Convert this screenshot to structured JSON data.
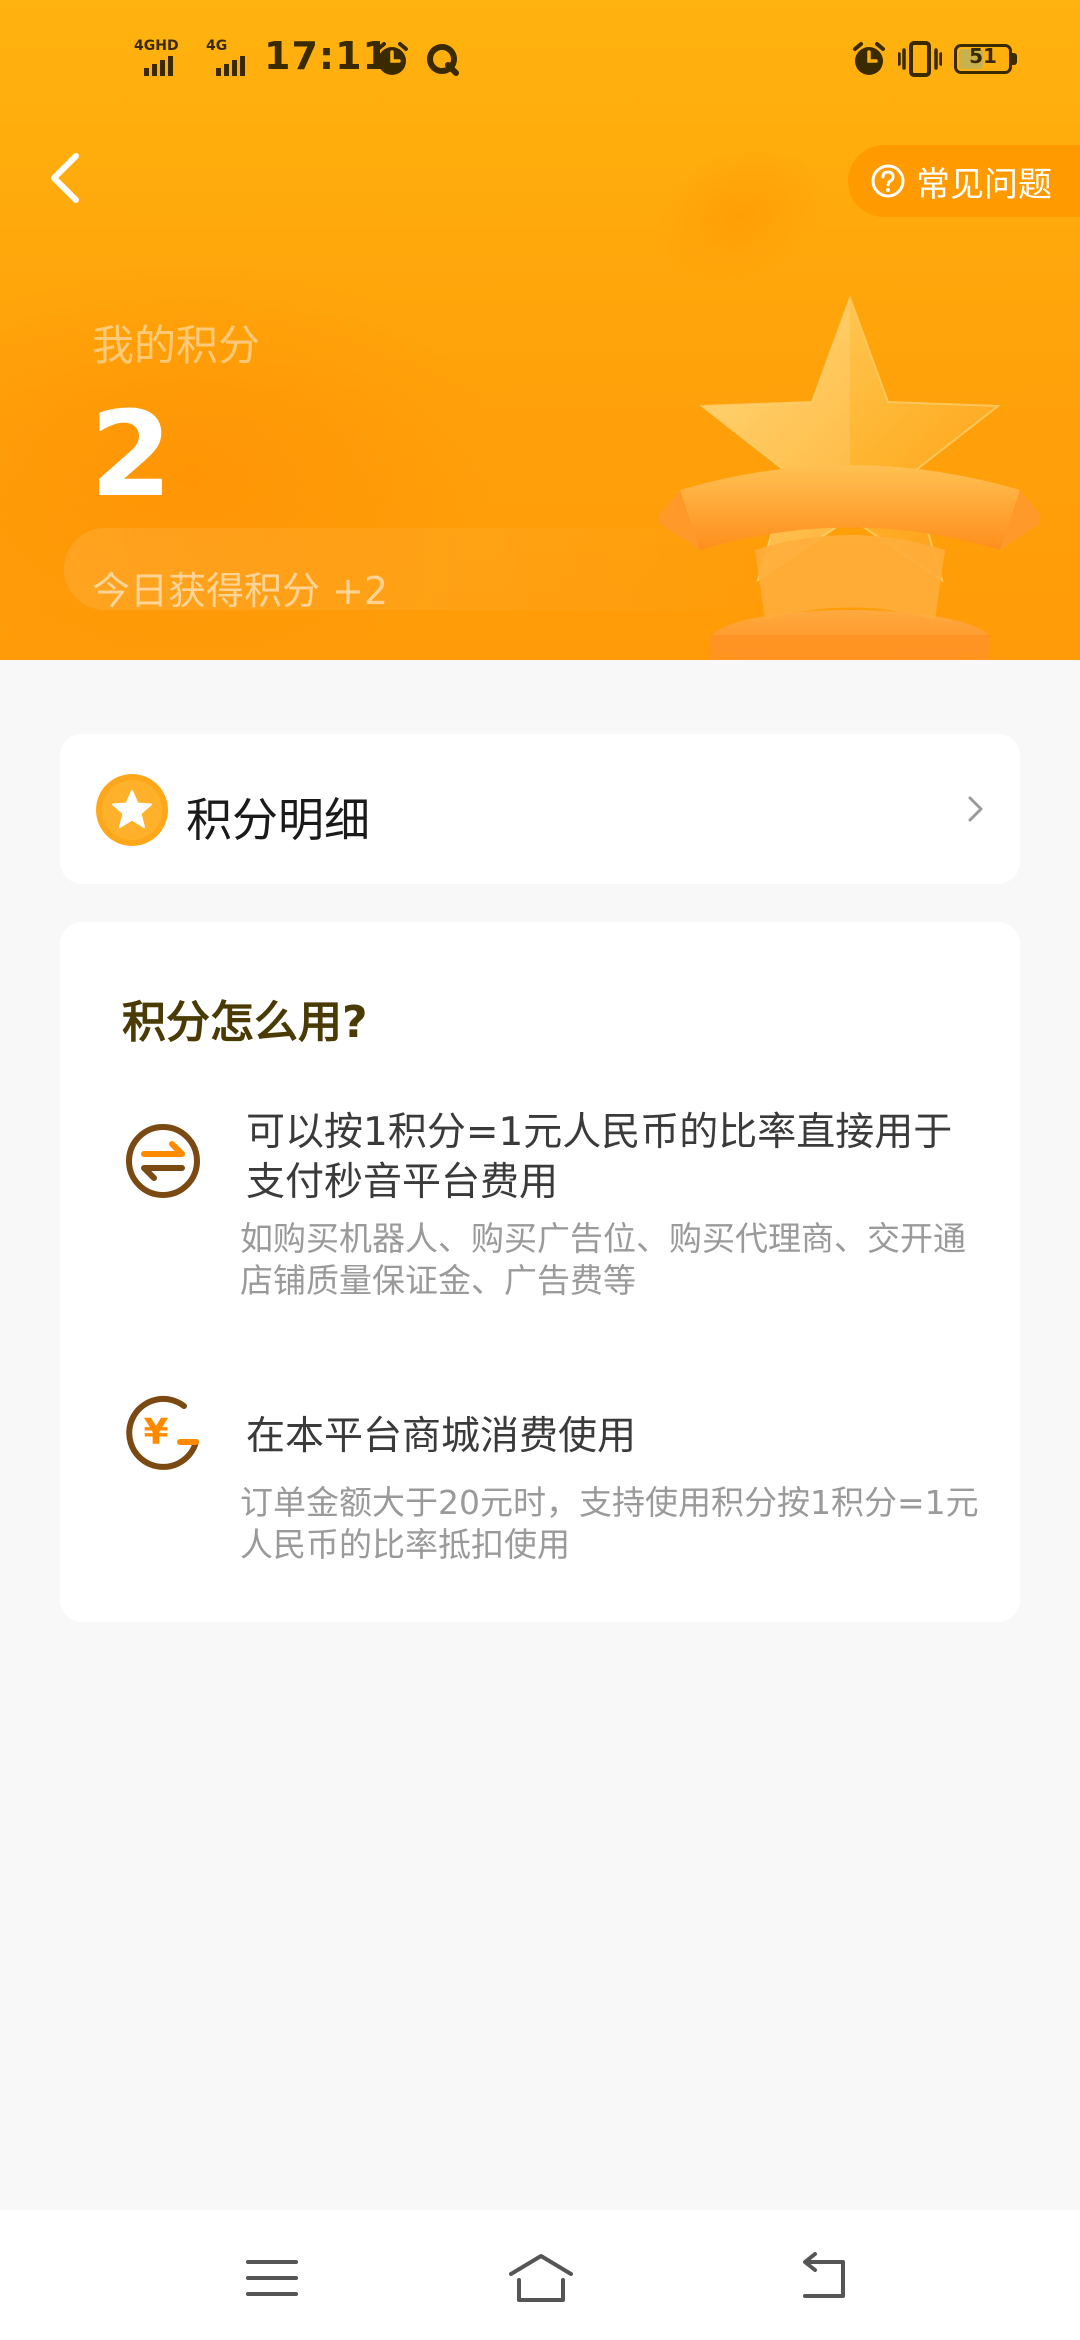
{
  "status_bar": {
    "network_1": "4GHD",
    "network_2": "4G",
    "time": "17:11",
    "battery_level": "51",
    "battery_fraction": 0.51
  },
  "header": {
    "faq_label": "常见问题"
  },
  "points": {
    "title": "我的积分",
    "value": "2",
    "today_text": "今日获得积分 +2"
  },
  "detail": {
    "label": "积分明细"
  },
  "usage": {
    "title": "积分怎么用?",
    "items": [
      {
        "icon": "exchange-icon",
        "main": "可以按1积分=1元人民币的比率直接用于支付秒音平台费用",
        "sub": "如购买机器人、购买广告位、购买代理商、交开通店铺质量保证金、广告费等"
      },
      {
        "icon": "yuan-coin-icon",
        "main": "在本平台商城消费使用",
        "sub": "订单金额大于20元时，支持使用积分按1积分=1元人民币的比率抵扣使用"
      }
    ]
  },
  "colors": {
    "hero_orange": "#ffa10a",
    "accent_orange": "#ff9a00",
    "usage_title": "#4a3b05",
    "icon_brown": "#7a4a12"
  },
  "nav": {
    "icons": [
      "menu-icon",
      "home-icon",
      "back-icon"
    ]
  }
}
